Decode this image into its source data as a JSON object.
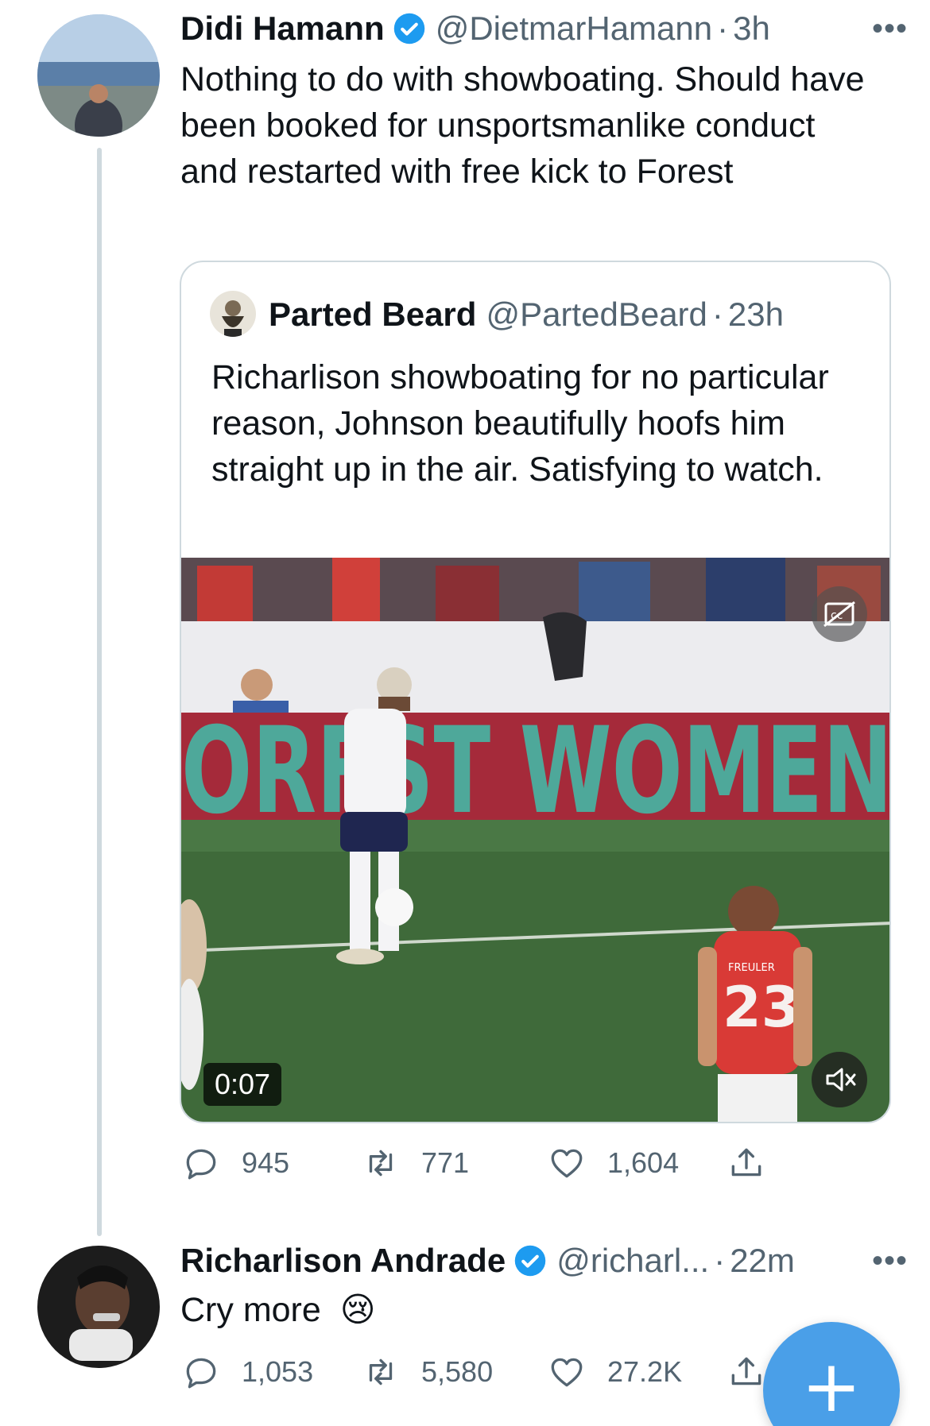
{
  "tweet": {
    "author_name": "Didi Hamann",
    "author_handle": "@DietmarHamann",
    "sep": "·",
    "time": "3h",
    "more": "•••",
    "text": "Nothing to do with showboating. Should have been booked for unsportsmanlike conduct and restarted with free kick to Forest",
    "quote": {
      "author_name": "Parted Beard",
      "author_handle": "@PartedBeard",
      "sep": "·",
      "time": "23h",
      "text": "Richarlison showboating for no particular reason, Johnson beautifully hoofs him straight up in the air. Satisfying to watch.",
      "video": {
        "duration": "0:07",
        "banner_text": "ORFST WOMEN",
        "shirt_name": "FREULER",
        "shirt_number": "23"
      }
    },
    "actions": {
      "replies": "945",
      "retweets": "771",
      "likes": "1,604"
    }
  },
  "reply": {
    "author_name": "Richarlison Andrade",
    "author_handle": "@richarl...",
    "sep": "·",
    "time": "22m",
    "more": "•••",
    "text": "Cry more",
    "emoji": "😢",
    "actions": {
      "replies": "1,053",
      "retweets": "5,580",
      "likes": "27.2K"
    }
  },
  "fab": {
    "label": "+"
  },
  "colors": {
    "verified": "#1d9bf0",
    "fab": "#4a9fe8",
    "secondary_text": "#536471"
  }
}
